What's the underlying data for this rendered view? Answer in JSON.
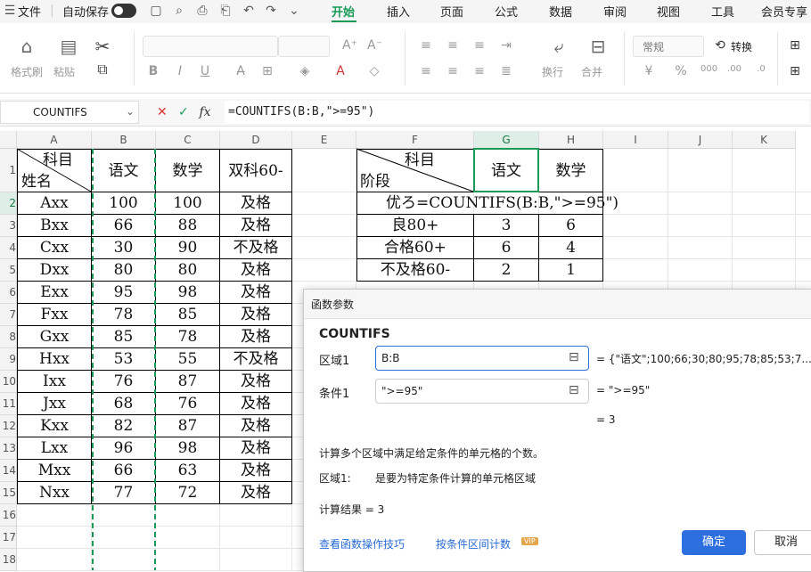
{
  "menubar": {
    "file": "文件",
    "autosave": "自动保存",
    "tabs": [
      "开始",
      "插入",
      "页面",
      "公式",
      "数据",
      "审阅",
      "视图",
      "工具",
      "会员专享"
    ]
  },
  "ribbon": {
    "format_painter": "格式刷",
    "paste": "粘贴",
    "font_bold": "B",
    "font_italic": "I",
    "font_underline": "U",
    "number_format": "常规",
    "convert": "转换",
    "wrap": "换行",
    "merge": "合并"
  },
  "formula_bar": {
    "name_box": "COUNTIFS",
    "fx": "fx",
    "formula": "=COUNTIFS(B:B,\">=95\")"
  },
  "sheet": {
    "columns": [
      "A",
      "B",
      "C",
      "D",
      "E",
      "F",
      "G",
      "H",
      "I",
      "J",
      "K"
    ],
    "rows": [
      "1",
      "2",
      "3",
      "4",
      "5",
      "6",
      "7",
      "8",
      "9",
      "10",
      "11",
      "12",
      "13",
      "14",
      "15",
      "16",
      "17",
      "18"
    ],
    "table1": {
      "header_subject": "科目",
      "header_name": "姓名",
      "col_b": "语文",
      "col_c": "数学",
      "col_d": "双科60-",
      "rows": [
        [
          "Axx",
          "100",
          "100",
          "及格"
        ],
        [
          "Bxx",
          "66",
          "88",
          "及格"
        ],
        [
          "Cxx",
          "30",
          "90",
          "不及格"
        ],
        [
          "Dxx",
          "80",
          "80",
          "及格"
        ],
        [
          "Exx",
          "95",
          "98",
          "及格"
        ],
        [
          "Fxx",
          "78",
          "85",
          "及格"
        ],
        [
          "Gxx",
          "85",
          "78",
          "及格"
        ],
        [
          "Hxx",
          "53",
          "55",
          "不及格"
        ],
        [
          "Ixx",
          "76",
          "87",
          "及格"
        ],
        [
          "Jxx",
          "68",
          "76",
          "及格"
        ],
        [
          "Kxx",
          "82",
          "87",
          "及格"
        ],
        [
          "Lxx",
          "96",
          "98",
          "及格"
        ],
        [
          "Mxx",
          "66",
          "63",
          "及格"
        ],
        [
          "Nxx",
          "77",
          "72",
          "及格"
        ]
      ]
    },
    "table2": {
      "header_subject": "科目",
      "header_stage": "阶段",
      "col_g": "语文",
      "col_h": "数学",
      "editing_row": "优ろ=COUNTIFS(B:B,\">=95\")",
      "rows": [
        [
          "良80+",
          "3",
          "6"
        ],
        [
          "合格60+",
          "6",
          "4"
        ],
        [
          "不及格60-",
          "2",
          "1"
        ]
      ]
    }
  },
  "dialog": {
    "title": "函数参数",
    "function_name": "COUNTIFS",
    "arg1_label": "区域1",
    "arg1_value": "B:B",
    "arg1_result": "= {\"语文\";100;66;30;80;95;78;85;53;7...",
    "arg2_label": "条件1",
    "arg2_value": "\">=95\"",
    "arg2_result": "= \">=95\"",
    "total_result": "= 3",
    "description": "计算多个区域中满足给定条件的单元格的个数。",
    "param_name": "区域1:",
    "param_desc": "是要为特定条件计算的单元格区域",
    "result_label": "计算结果  =  3",
    "link_tips": "查看函数操作技巧",
    "link_interval": "按条件区间计数",
    "vip": "VIP",
    "ok": "确定",
    "cancel": "取消"
  }
}
